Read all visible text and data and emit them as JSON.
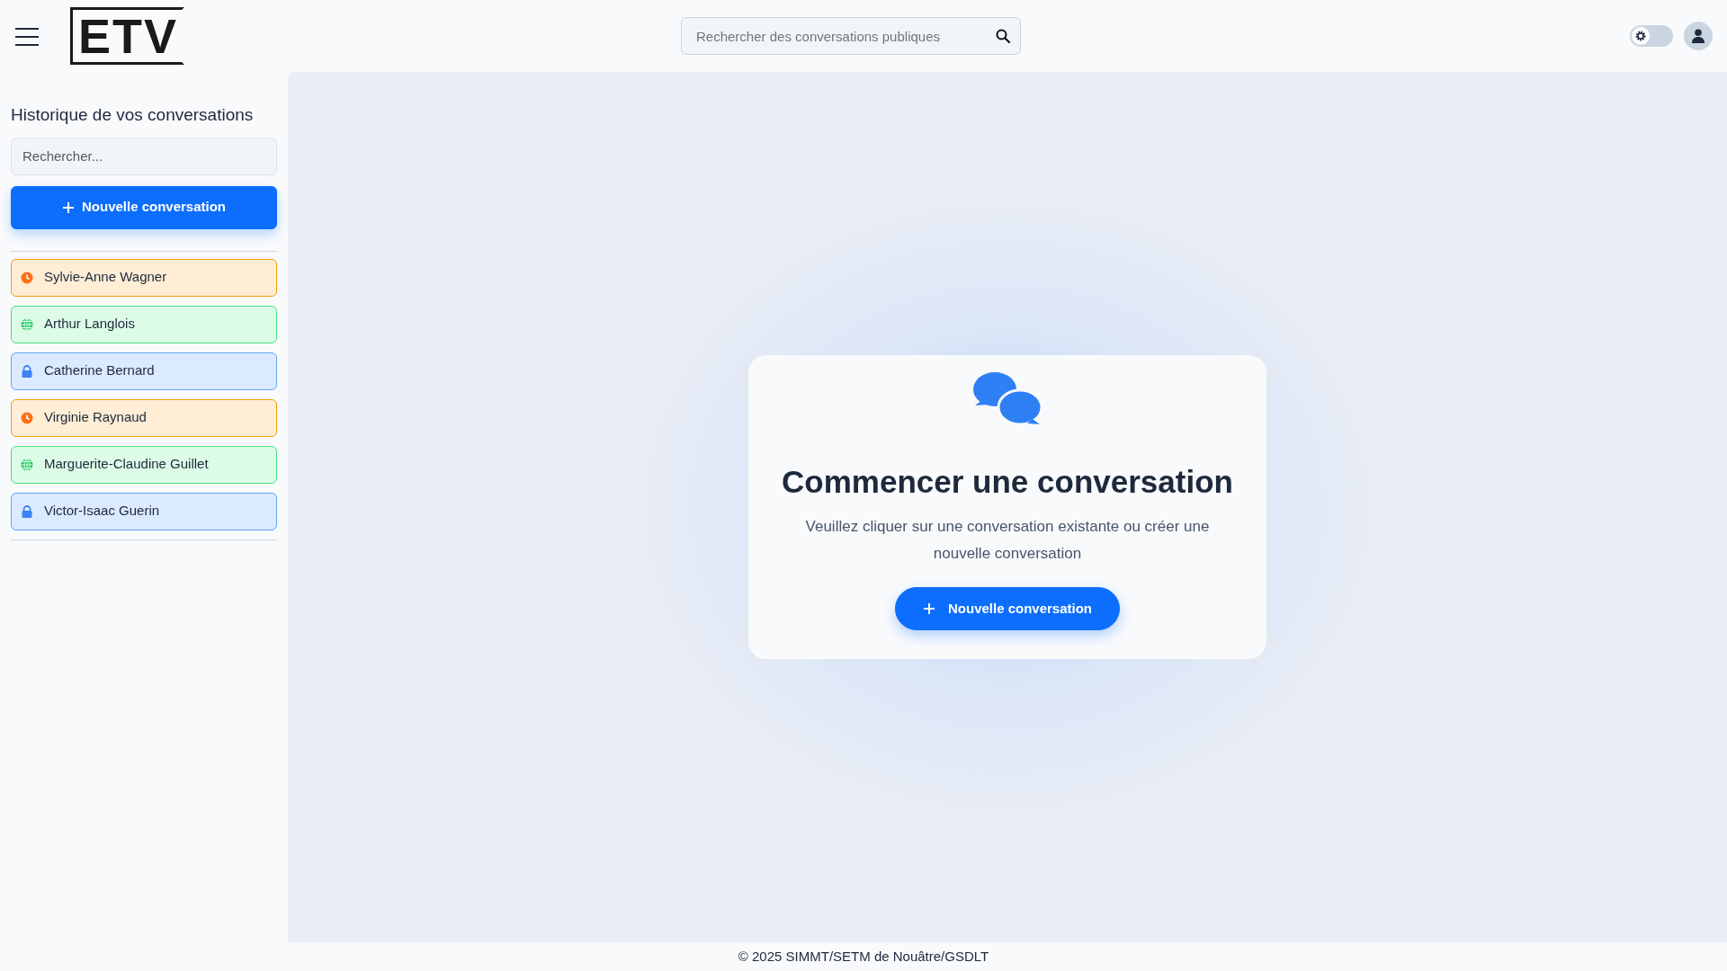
{
  "header": {
    "logo": "ETV",
    "search": {
      "placeholder": "Rechercher des conversations publiques"
    },
    "theme_toggle": {
      "on": false
    }
  },
  "sidebar": {
    "title": "Historique de vos conversations",
    "search": {
      "placeholder": "Rechercher..."
    },
    "new_button": "Nouvelle conversation",
    "conversations": [
      {
        "name": "Sylvie-Anne Wagner",
        "kind": "pending"
      },
      {
        "name": "Arthur Langlois",
        "kind": "public"
      },
      {
        "name": "Catherine Bernard",
        "kind": "private"
      },
      {
        "name": "Virginie Raynaud",
        "kind": "pending"
      },
      {
        "name": "Marguerite-Claudine Guillet",
        "kind": "public"
      },
      {
        "name": "Victor-Isaac Guerin",
        "kind": "private"
      }
    ]
  },
  "welcome": {
    "title": "Commencer une conversation",
    "text": "Veuillez cliquer sur une conversation existante ou créer une nouvelle conversation",
    "button": "Nouvelle conversation"
  },
  "footer": "© 2025 SIMMT/SETM de Nouâtre/GSDLT"
}
